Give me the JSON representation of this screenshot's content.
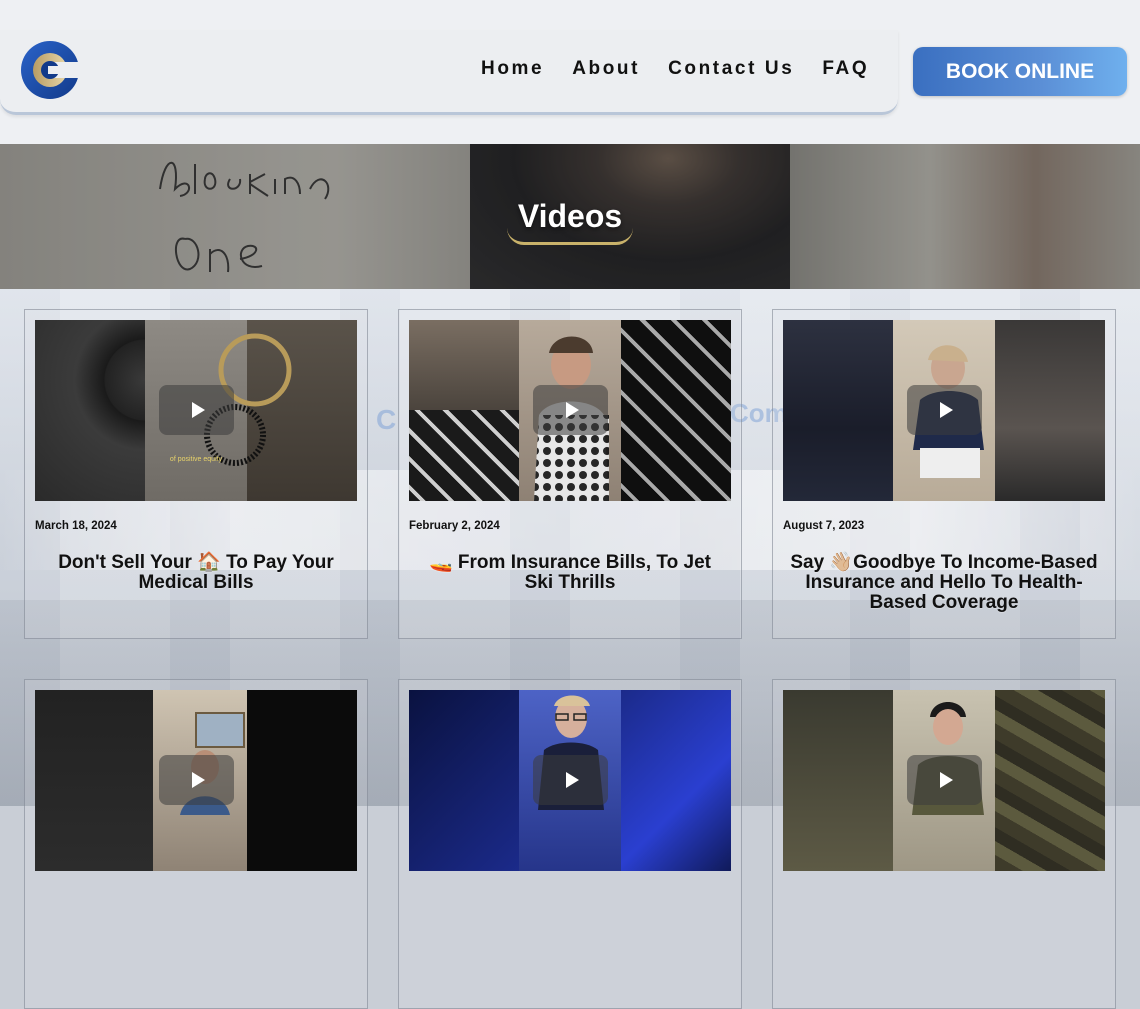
{
  "header": {
    "logo_name": "company-logo",
    "nav": [
      {
        "label": "Home"
      },
      {
        "label": "About"
      },
      {
        "label": "Contact Us"
      },
      {
        "label": "FAQ"
      }
    ],
    "cta_label": "BOOK ONLINE"
  },
  "hero": {
    "title": "Videos",
    "scribble_text": "Blocking One"
  },
  "watermark_text": "Com",
  "videos": [
    {
      "date": "March 18, 2024",
      "title": "Don't Sell Your 🏠 To Pay Your Medical Bills",
      "thumb_caption": "of positive equity"
    },
    {
      "date": "February 2, 2024",
      "title": "🚤 From Insurance Bills, To Jet Ski Thrills"
    },
    {
      "date": "August 7, 2023",
      "title": "Say 👋🏼Goodbye To Income-Based Insurance and Hello To Health-Based Coverage"
    },
    {
      "date": "",
      "title": ""
    },
    {
      "date": "",
      "title": ""
    },
    {
      "date": "",
      "title": ""
    }
  ],
  "colors": {
    "accent_blue": "#3a6fc0",
    "gold": "#c9b26a",
    "nav_text": "#111111"
  }
}
